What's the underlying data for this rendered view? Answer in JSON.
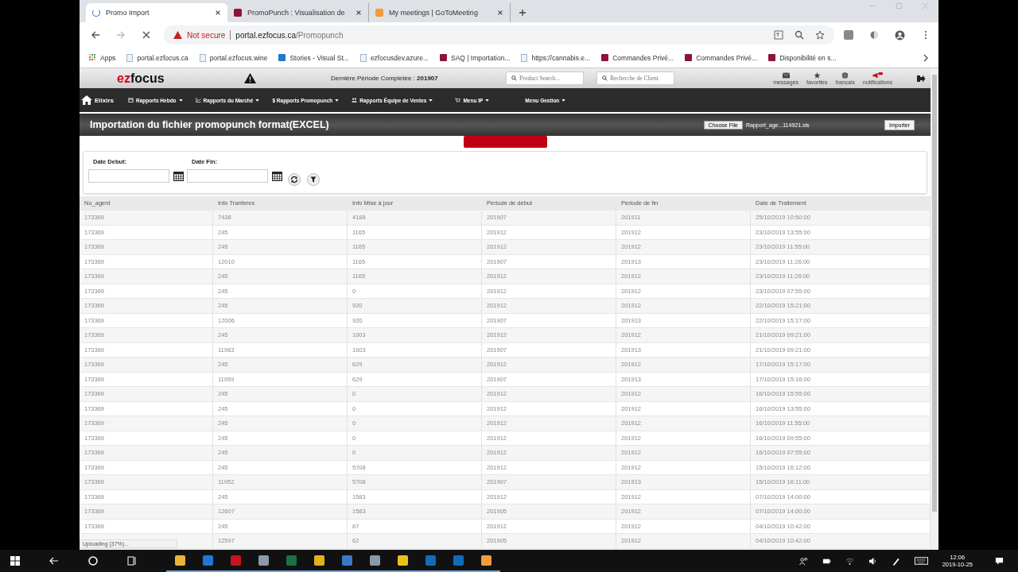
{
  "browser": {
    "tabs": [
      {
        "title": "Promo Import",
        "kind": "loading",
        "selected": true
      },
      {
        "title": "PromoPunch : Visualisation de",
        "kind": "site",
        "selected": false
      },
      {
        "title": "My meetings | GoToMeeting",
        "kind": "meeting",
        "selected": false
      }
    ],
    "address": {
      "security": "Not secure",
      "host": "portal.ezfocus.ca",
      "path": "/Promopunch"
    },
    "bookmarks": [
      {
        "label": "Apps",
        "kind": "apps"
      },
      {
        "label": "portal.ezfocus.ca",
        "kind": "page"
      },
      {
        "label": "portal.ezfocus.wine",
        "kind": "page"
      },
      {
        "label": "Stories - Visual St...",
        "kind": "cloud"
      },
      {
        "label": "ezfocusdev.azure...",
        "kind": "page"
      },
      {
        "label": "SAQ | Importation...",
        "kind": "site"
      },
      {
        "label": "https://cannabis.e...",
        "kind": "page"
      },
      {
        "label": "Commandes Privé...",
        "kind": "site"
      },
      {
        "label": "Commandes Privé...",
        "kind": "site"
      },
      {
        "label": "Disponibilité en s...",
        "kind": "site"
      }
    ]
  },
  "app": {
    "logo": {
      "first": "ez",
      "second": "focus"
    },
    "period_label": "Dernière Période Completée : ",
    "period": "201907",
    "product_search": {
      "placeholder": "Product Search..."
    },
    "client_search": {
      "placeholder": "Recherche de Client"
    },
    "header_icons": [
      {
        "label": "messages",
        "kind": "mail"
      },
      {
        "label": "favorites",
        "kind": "star"
      },
      {
        "label": "francais",
        "kind": "globe"
      },
      {
        "label": "notifications",
        "kind": "megaphone"
      }
    ],
    "nav": [
      {
        "label": "Elixirs",
        "kind": "home",
        "dropdown": false
      },
      {
        "label": "Rapports Hebdo",
        "kind": "calendar",
        "dropdown": true
      },
      {
        "label": "Rapports du Marché",
        "kind": "chart",
        "dropdown": true
      },
      {
        "label": "$ Rapports Promopunch",
        "kind": "none",
        "dropdown": true
      },
      {
        "label": "Rapports Équipe de Ventes",
        "kind": "users",
        "dropdown": true
      },
      {
        "label": "Menu IP",
        "kind": "cart",
        "dropdown": true
      },
      {
        "label": "Menu Gestion",
        "kind": "none",
        "dropdown": true
      }
    ],
    "page_title": "Importation du fichier promopunch format(EXCEL)",
    "file": {
      "button": "Choose File",
      "name": "Rapport_age...114921.xls"
    },
    "import_button": "Importer",
    "filters": [
      {
        "label": "Date Debut:"
      },
      {
        "label": "Date Fin:"
      }
    ],
    "table": {
      "columns": [
        "No_agent",
        "Info Tranferes",
        "Info Mise à jour",
        "Periode de debut",
        "Periode de fin",
        "Date de Traitement"
      ],
      "rows": [
        [
          "173369",
          "7438",
          "4188",
          "201907",
          "201911",
          "25/10/2019 10:50:00"
        ],
        [
          "173369",
          "245",
          "1165",
          "201912",
          "201912",
          "23/10/2019 13:55:00"
        ],
        [
          "173369",
          "245",
          "1165",
          "201912",
          "201912",
          "23/10/2019 11:55:00"
        ],
        [
          "173369",
          "12010",
          "1165",
          "201907",
          "201913",
          "23/10/2019 11:26:00"
        ],
        [
          "173369",
          "245",
          "1165",
          "201912",
          "201912",
          "23/10/2019 11:26:00"
        ],
        [
          "173369",
          "245",
          "0",
          "201912",
          "201912",
          "23/10/2019 07:55:00"
        ],
        [
          "173369",
          "245",
          "920",
          "201912",
          "201912",
          "22/10/2019 15:21:00"
        ],
        [
          "173369",
          "12006",
          "920",
          "201907",
          "201913",
          "22/10/2019 15:17:00"
        ],
        [
          "173369",
          "245",
          "1003",
          "201912",
          "201912",
          "21/10/2019 09:21:00"
        ],
        [
          "173369",
          "11983",
          "1003",
          "201907",
          "201913",
          "21/10/2019 09:21:00"
        ],
        [
          "173369",
          "245",
          "629",
          "201912",
          "201912",
          "17/10/2019 15:17:00"
        ],
        [
          "173369",
          "11959",
          "629",
          "201907",
          "201913",
          "17/10/2019 15:16:00"
        ],
        [
          "173369",
          "245",
          "0",
          "201912",
          "201912",
          "16/10/2019 15:55:00"
        ],
        [
          "173369",
          "245",
          "0",
          "201912",
          "201912",
          "16/10/2019 13:55:00"
        ],
        [
          "173369",
          "245",
          "0",
          "201912",
          "201912",
          "16/10/2019 11:55:00"
        ],
        [
          "173369",
          "245",
          "0",
          "201912",
          "201912",
          "16/10/2019 09:55:00"
        ],
        [
          "173369",
          "245",
          "0",
          "201912",
          "201912",
          "16/10/2019 07:55:00"
        ],
        [
          "173369",
          "245",
          "5708",
          "201912",
          "201912",
          "15/10/2019 16:12:00"
        ],
        [
          "173369",
          "11952",
          "5708",
          "201907",
          "201913",
          "15/10/2019 16:11:00"
        ],
        [
          "173369",
          "245",
          "1583",
          "201912",
          "201912",
          "07/10/2019 14:00:00"
        ],
        [
          "173369",
          "12607",
          "1583",
          "201905",
          "201912",
          "07/10/2019 14:00:00"
        ],
        [
          "173369",
          "245",
          "67",
          "201912",
          "201912",
          "04/10/2019 10:42:00"
        ],
        [
          "",
          "12597",
          "62",
          "201905",
          "201912",
          "04/10/2019 10:42:00"
        ]
      ]
    },
    "progress": {
      "level": 1
    },
    "status": "Uploading (37%)..."
  },
  "taskbar": {
    "apps": [
      {
        "kind": "explorer"
      },
      {
        "kind": "edge"
      },
      {
        "kind": "acrobat"
      },
      {
        "kind": "tool"
      },
      {
        "kind": "excel"
      },
      {
        "kind": "chrome"
      },
      {
        "kind": "store"
      },
      {
        "kind": "tool"
      },
      {
        "kind": "powerbi"
      },
      {
        "kind": "outlook"
      },
      {
        "kind": "outlook"
      },
      {
        "kind": "meeting"
      }
    ],
    "time": "12:06",
    "date": "2019-10-25"
  }
}
